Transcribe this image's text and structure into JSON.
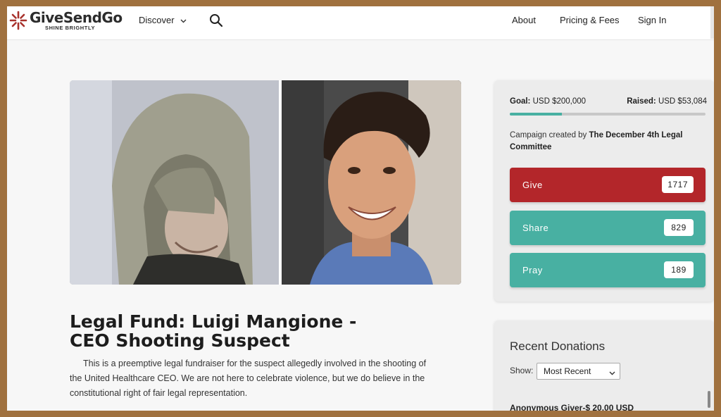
{
  "brand": {
    "name": "GiveSendGo",
    "tagline": "SHINE BRIGHTLY"
  },
  "nav": {
    "discover": "Discover",
    "about": "About",
    "pricing": "Pricing & Fees",
    "signin": "Sign In"
  },
  "campaign": {
    "title": "Legal Fund: Luigi Mangione - CEO Shooting Suspect",
    "description": "This is a preemptive legal fundraiser for the suspect allegedly involved in the shooting of the United Healthcare CEO. We are not here to celebrate violence, but we do believe in the constitutional right of fair legal representation.",
    "goal_label": "Goal:",
    "goal_value": "USD $200,000",
    "raised_label": "Raised:",
    "raised_value": "USD $53,084",
    "progress_fraction": 0.265,
    "creator_prefix": "Campaign created by",
    "creator_name": "The December 4th Legal Committee"
  },
  "actions": [
    {
      "label": "Give",
      "count": "1717",
      "color": "#b3262a"
    },
    {
      "label": "Share",
      "count": "829",
      "color": "#48b0a2"
    },
    {
      "label": "Pray",
      "count": "189",
      "color": "#48b0a2"
    }
  ],
  "donations": {
    "title": "Recent Donations",
    "show_label": "Show:",
    "selected": "Most Recent",
    "first_item": "Anonymous Giver-$ 20.00 USD"
  },
  "icons": {
    "logo": "starburst-logo-icon",
    "search": "search-icon",
    "discover_caret": "chevron-down-icon"
  }
}
